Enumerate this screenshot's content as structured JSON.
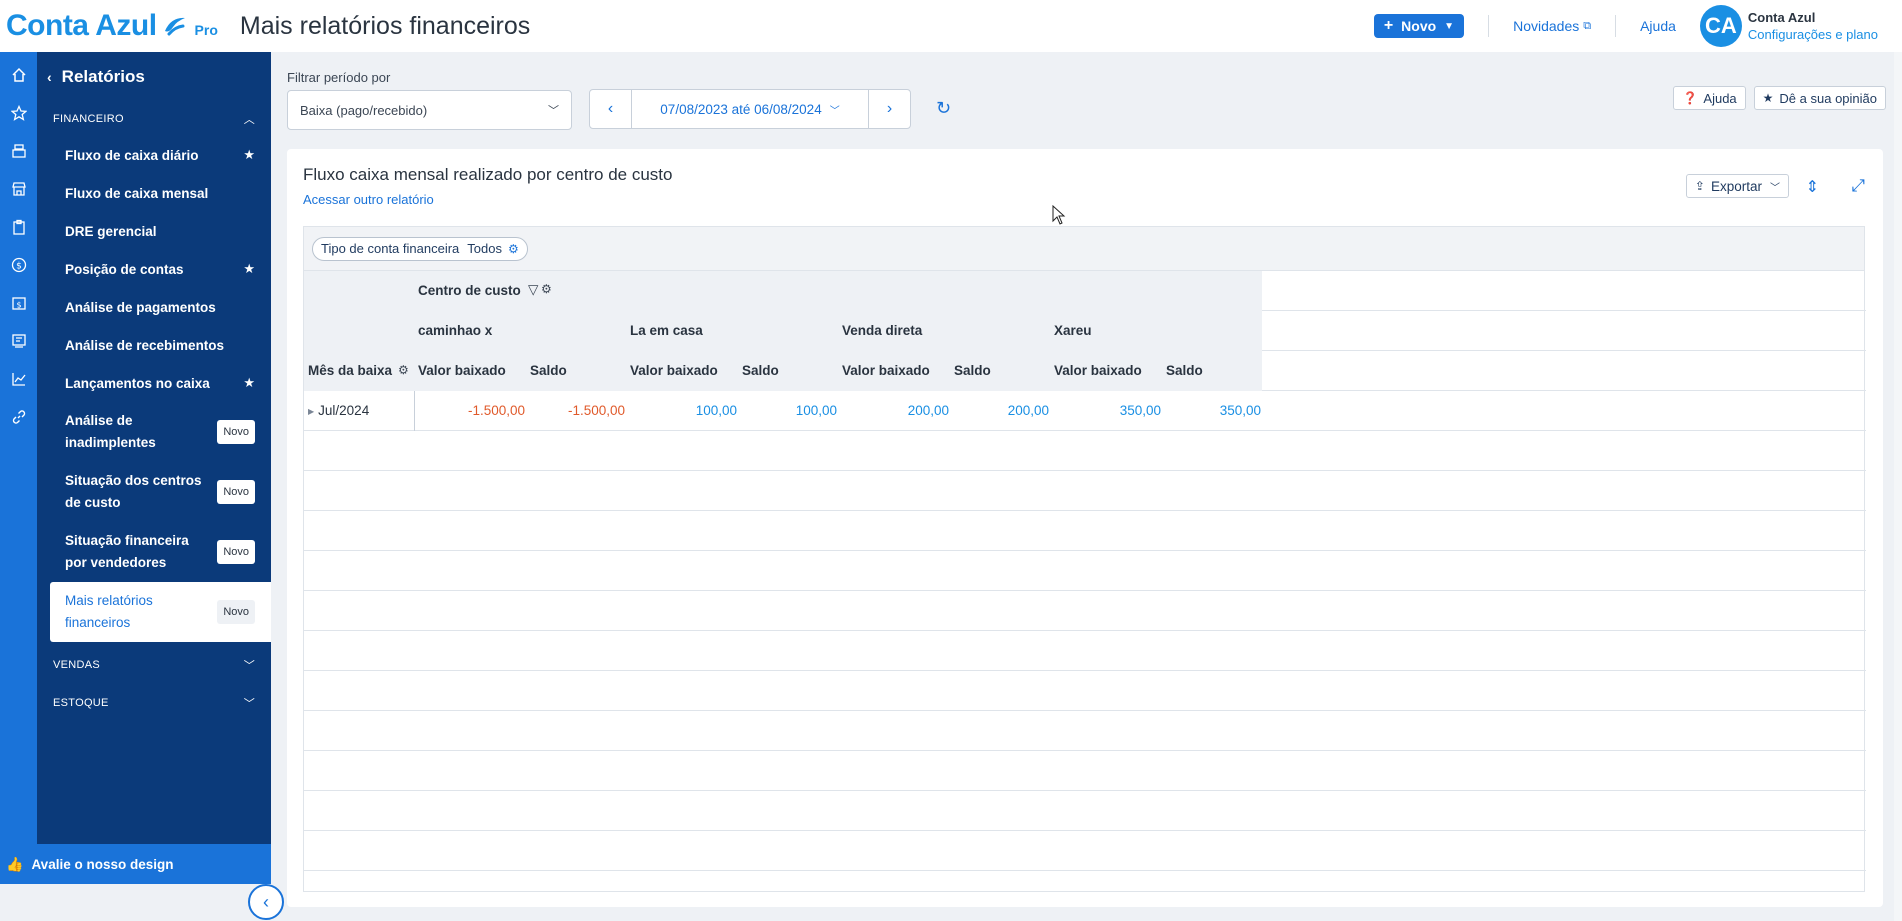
{
  "header": {
    "brand": "Conta Azul",
    "brand_tier": "Pro",
    "page_title": "Mais relatórios financeiros",
    "new_button": "Novo",
    "news_link": "Novidades",
    "help_link": "Ajuda",
    "avatar_initials": "CA",
    "account_name": "Conta Azul",
    "account_sub": "Configurações e plano"
  },
  "rail_icons": [
    "home-icon",
    "star-icon",
    "cash-register-icon",
    "store-icon",
    "clipboard-icon",
    "dollar-icon",
    "calendar-dollar-icon",
    "receipt-icon",
    "chart-line-icon",
    "link-icon"
  ],
  "sidebar": {
    "title": "Relatórios",
    "sections": {
      "financeiro": "FINANCEIRO",
      "vendas": "VENDAS",
      "estoque": "ESTOQUE"
    },
    "items": [
      {
        "label": "Fluxo de caixa diário",
        "starred": true
      },
      {
        "label": "Fluxo de caixa mensal",
        "starred": false
      },
      {
        "label": "DRE gerencial",
        "starred": false
      },
      {
        "label": "Posição de contas",
        "starred": true
      },
      {
        "label": "Análise de pagamentos",
        "starred": false
      },
      {
        "label": "Análise de recebimentos",
        "starred": false
      },
      {
        "label": "Lançamentos no caixa",
        "starred": true
      },
      {
        "label": "Análise de inadimplentes",
        "badge": "Novo"
      },
      {
        "label": "Situação dos centros de custo",
        "badge": "Novo"
      },
      {
        "label": "Situação financeira por vendedores",
        "badge": "Novo"
      },
      {
        "label": "Mais relatórios financeiros",
        "badge": "Novo",
        "active": true
      }
    ],
    "footer": "Avalie o nosso design"
  },
  "filters": {
    "period_label": "Filtrar período por",
    "period_value": "Baixa (pago/recebido)",
    "date_range": "07/08/2023 até 06/08/2024",
    "help_button": "Ajuda",
    "feedback_button": "Dê a sua opinião"
  },
  "report": {
    "title": "Fluxo caixa mensal realizado por centro de custo",
    "other_link": "Acessar outro relatório",
    "export_button": "Exportar",
    "chip_label": "Tipo de conta financeira",
    "chip_value": "Todos",
    "group_header": "Centro de custo",
    "row_header": "Mês da baixa",
    "centers": [
      "caminhao x",
      "La em casa",
      "Venda direta",
      "Xareu"
    ],
    "col_valor": "Valor baixado",
    "col_saldo": "Saldo",
    "rows": [
      {
        "label": "Jul/2024",
        "values": [
          "-1.500,00",
          "-1.500,00",
          "100,00",
          "100,00",
          "200,00",
          "200,00",
          "350,00",
          "350,00"
        ]
      }
    ]
  },
  "colors": {
    "brand": "#1a8fe3",
    "sidebar": "#0b3a7a",
    "negative": "#e05a2b",
    "positive": "#1a8fe3"
  }
}
